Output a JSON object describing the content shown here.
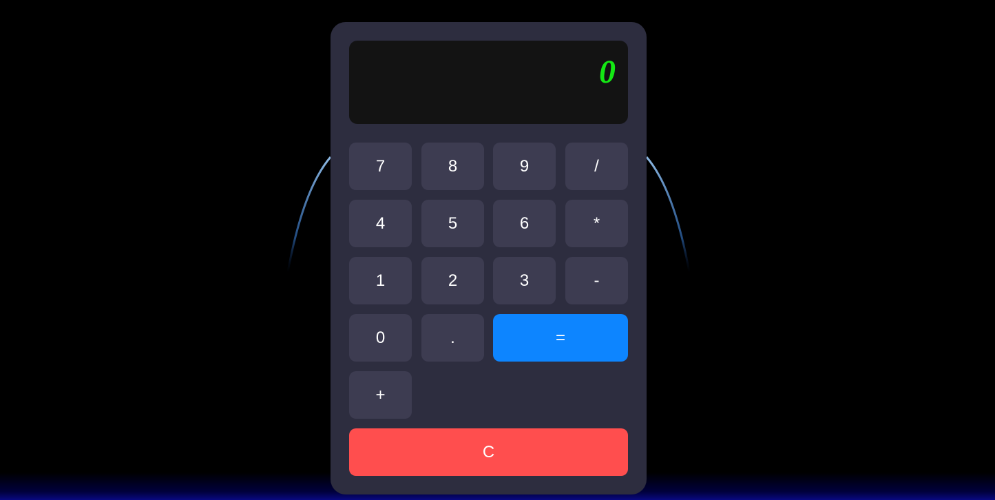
{
  "display": {
    "value": "0",
    "color": "#14e814"
  },
  "keys": {
    "row1": [
      "7",
      "8",
      "9",
      "/"
    ],
    "row2": [
      "4",
      "5",
      "6",
      "*"
    ],
    "row3": [
      "1",
      "2",
      "3",
      "-"
    ],
    "row4": [
      "0",
      ".",
      "="
    ],
    "row5": [
      "+"
    ],
    "clear": "C"
  },
  "colors": {
    "background": "#000000",
    "calculator_body": "#2d2d3f",
    "display_background": "#131313",
    "key": "#3d3c51",
    "equals_key": "#0d85ff",
    "clear_key": "#ff4e4e"
  }
}
